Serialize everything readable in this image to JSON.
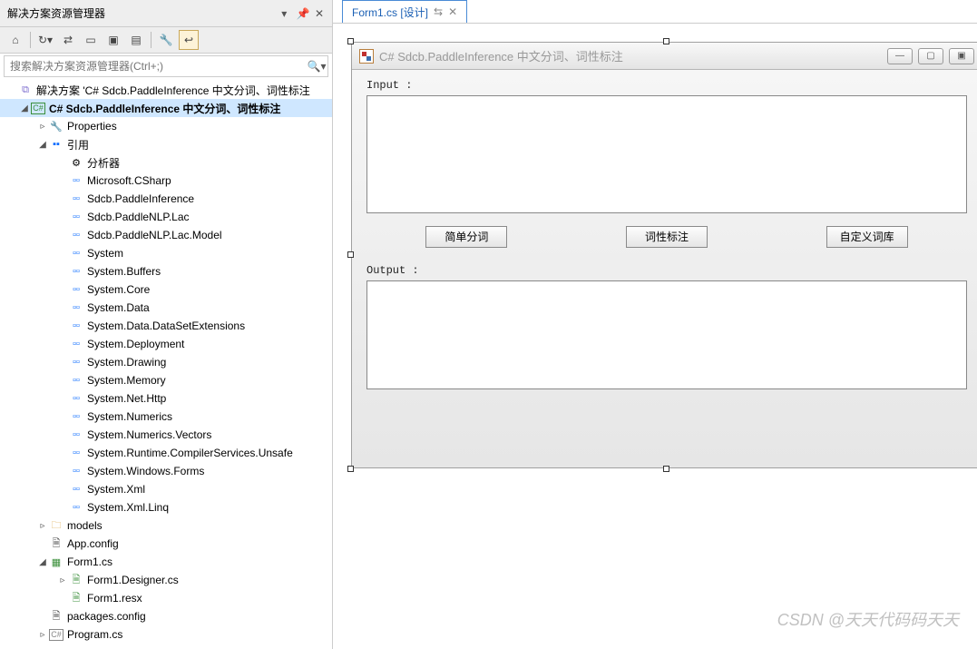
{
  "se": {
    "title": "解决方案资源管理器",
    "search_placeholder": "搜索解决方案资源管理器(Ctrl+;)",
    "solution_label": "解决方案 'C# Sdcb.PaddleInference 中文分词、词性标注",
    "project_label": "C# Sdcb.PaddleInference 中文分词、词性标注",
    "properties_label": "Properties",
    "references_label": "引用",
    "analyzer_label": "分析器",
    "refs": [
      "Microsoft.CSharp",
      "Sdcb.PaddleInference",
      "Sdcb.PaddleNLP.Lac",
      "Sdcb.PaddleNLP.Lac.Model",
      "System",
      "System.Buffers",
      "System.Core",
      "System.Data",
      "System.Data.DataSetExtensions",
      "System.Deployment",
      "System.Drawing",
      "System.Memory",
      "System.Net.Http",
      "System.Numerics",
      "System.Numerics.Vectors",
      "System.Runtime.CompilerServices.Unsafe",
      "System.Windows.Forms",
      "System.Xml",
      "System.Xml.Linq"
    ],
    "models_label": "models",
    "appconfig_label": "App.config",
    "form1_label": "Form1.cs",
    "form1_designer_label": "Form1.Designer.cs",
    "form1_resx_label": "Form1.resx",
    "packages_label": "packages.config",
    "program_label": "Program.cs"
  },
  "tab": {
    "label": "Form1.cs [设计]"
  },
  "form": {
    "title": "C# Sdcb.PaddleInference 中文分词、词性标注",
    "input_label": "Input :",
    "output_label": "Output :",
    "btn1": "简单分词",
    "btn2": "词性标注",
    "btn3": "自定义词库"
  },
  "watermark": "CSDN @天天代码码天天"
}
